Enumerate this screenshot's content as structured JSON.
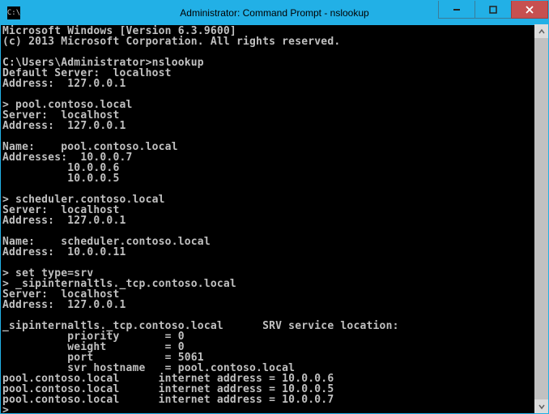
{
  "window": {
    "title": "Administrator: Command Prompt - nslookup"
  },
  "terminal": {
    "lines": [
      "Microsoft Windows [Version 6.3.9600]",
      "(c) 2013 Microsoft Corporation. All rights reserved.",
      "",
      "C:\\Users\\Administrator>nslookup",
      "Default Server:  localhost",
      "Address:  127.0.0.1",
      "",
      "> pool.contoso.local",
      "Server:  localhost",
      "Address:  127.0.0.1",
      "",
      "Name:    pool.contoso.local",
      "Addresses:  10.0.0.7",
      "          10.0.0.6",
      "          10.0.0.5",
      "",
      "> scheduler.contoso.local",
      "Server:  localhost",
      "Address:  127.0.0.1",
      "",
      "Name:    scheduler.contoso.local",
      "Address:  10.0.0.11",
      "",
      "> set type=srv",
      "> _sipinternaltls._tcp.contoso.local",
      "Server:  localhost",
      "Address:  127.0.0.1",
      "",
      "_sipinternaltls._tcp.contoso.local      SRV service location:",
      "          priority       = 0",
      "          weight         = 0",
      "          port           = 5061",
      "          svr hostname   = pool.contoso.local",
      "pool.contoso.local      internet address = 10.0.0.6",
      "pool.contoso.local      internet address = 10.0.0.5",
      "pool.contoso.local      internet address = 10.0.0.7",
      "> _"
    ]
  }
}
